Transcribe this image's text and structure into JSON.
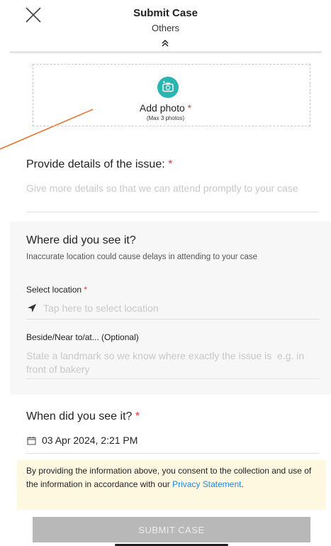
{
  "header": {
    "title": "Submit Case",
    "subtitle": "Others"
  },
  "photo": {
    "label": "Add photo",
    "required_mark": "*",
    "hint": "(Max 3 photos)",
    "accent_color": "#2bb5b0"
  },
  "details": {
    "title": "Provide details of the issue:",
    "required_mark": "*",
    "placeholder": "Give more details so that we can attend promptly to your case"
  },
  "where": {
    "title": "Where did you see it?",
    "note": "Inaccurate location could cause delays in attending to your case",
    "location_label": "Select location",
    "location_required_mark": "*",
    "location_placeholder": "Tap here to select location",
    "near_label": "Beside/Near to/at... (Optional)",
    "near_placeholder": "State a landmark so we know where exactly the issue is  e.g. in front of bakery"
  },
  "when": {
    "title": "When did you see it?",
    "required_mark": "*",
    "value": "03 Apr 2024, 2:21 PM"
  },
  "consent": {
    "text_before": "By providing the information above, you consent to the collection and use of the information in accordance with our ",
    "link": "Privacy Statement",
    "text_after": "."
  },
  "submit": {
    "label": "SUBMIT CASE"
  },
  "icons": {
    "close": "close-icon",
    "chevron": "double-chevron-up-icon",
    "camera": "camera-icon",
    "location": "location-arrow-icon",
    "calendar": "calendar-icon"
  },
  "colors": {
    "required": "#e53935",
    "link": "#1e88e5",
    "consent_bg": "#fff8e1",
    "submit_disabled": "#b8b8b8",
    "annotation_line": "#e8712a"
  }
}
